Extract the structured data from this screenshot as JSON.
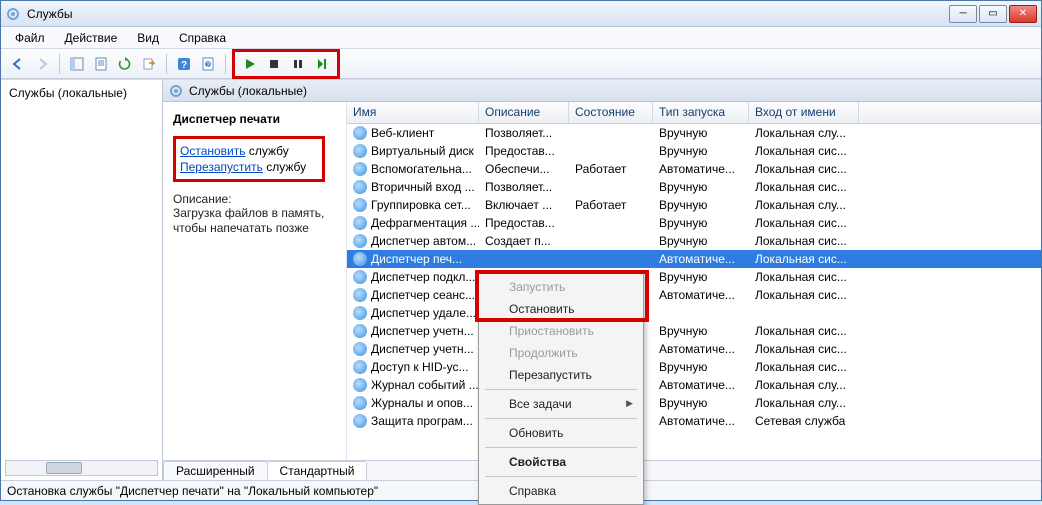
{
  "window": {
    "title": "Службы",
    "min_tooltip": "Свернуть",
    "max_tooltip": "Развернуть",
    "close_tooltip": "Закрыть"
  },
  "menu": {
    "file": "Файл",
    "action": "Действие",
    "view": "Вид",
    "help": "Справка"
  },
  "tree": {
    "root": "Службы (локальные)"
  },
  "pane_header": {
    "title": "Службы (локальные)"
  },
  "detail": {
    "title": "Диспетчер печати",
    "stop_link": "Остановить",
    "stop_suffix": " службу",
    "restart_link": "Перезапустить",
    "restart_suffix": " службу",
    "desc_head": "Описание:",
    "desc_body": "Загрузка файлов в память, чтобы напечатать позже"
  },
  "columns": {
    "name": "Имя",
    "description": "Описание",
    "state": "Состояние",
    "startup": "Тип запуска",
    "logon": "Вход от имени"
  },
  "rows": [
    {
      "name": "Веб-клиент",
      "desc": "Позволяет...",
      "state": "",
      "startup": "Вручную",
      "logon": "Локальная слу..."
    },
    {
      "name": "Виртуальный диск",
      "desc": "Предостав...",
      "state": "",
      "startup": "Вручную",
      "logon": "Локальная сис..."
    },
    {
      "name": "Вспомогательна...",
      "desc": "Обеспечи...",
      "state": "Работает",
      "startup": "Автоматиче...",
      "logon": "Локальная сис..."
    },
    {
      "name": "Вторичный вход ...",
      "desc": "Позволяет...",
      "state": "",
      "startup": "Вручную",
      "logon": "Локальная сис..."
    },
    {
      "name": "Группировка сет...",
      "desc": "Включает ...",
      "state": "Работает",
      "startup": "Вручную",
      "logon": "Локальная слу..."
    },
    {
      "name": "Дефрагментация ...",
      "desc": "Предостав...",
      "state": "",
      "startup": "Вручную",
      "logon": "Локальная сис..."
    },
    {
      "name": "Диспетчер автом...",
      "desc": "Создает п...",
      "state": "",
      "startup": "Вручную",
      "logon": "Локальная сис..."
    },
    {
      "name": "Диспетчер печ...",
      "desc": "",
      "state": "",
      "startup": "Автоматиче...",
      "logon": "Локальная сис...",
      "selected": true
    },
    {
      "name": "Диспетчер подкл...",
      "desc": "",
      "state": "",
      "startup": "Вручную",
      "logon": "Локальная сис..."
    },
    {
      "name": "Диспетчер сеанс...",
      "desc": "",
      "state": "",
      "startup": "Автоматиче...",
      "logon": "Локальная сис..."
    },
    {
      "name": "Диспетчер удале...",
      "desc": "",
      "state": "",
      "startup": "",
      "logon": ""
    },
    {
      "name": "Диспетчер учетн...",
      "desc": "",
      "state": "",
      "startup": "Вручную",
      "logon": "Локальная сис..."
    },
    {
      "name": "Диспетчер учетн...",
      "desc": "",
      "state": "",
      "startup": "Автоматиче...",
      "logon": "Локальная сис..."
    },
    {
      "name": "Доступ к HID-ус...",
      "desc": "",
      "state": "",
      "startup": "Вручную",
      "logon": "Локальная сис..."
    },
    {
      "name": "Журнал событий ...",
      "desc": "",
      "state": "",
      "startup": "Автоматиче...",
      "logon": "Локальная слу..."
    },
    {
      "name": "Журналы и опов...",
      "desc": "",
      "state": "",
      "startup": "Вручную",
      "logon": "Локальная слу..."
    },
    {
      "name": "Защита програм...",
      "desc": "",
      "state": "",
      "startup": "Автоматиче...",
      "logon": "Сетевая служба"
    }
  ],
  "tabs": {
    "extended": "Расширенный",
    "standard": "Стандартный"
  },
  "status": "Остановка службы \"Диспетчер печати\" на \"Локальный компьютер\"",
  "context_menu": {
    "start": "Запустить",
    "stop": "Остановить",
    "pause": "Приостановить",
    "resume": "Продолжить",
    "restart": "Перезапустить",
    "all_tasks": "Все задачи",
    "refresh": "Обновить",
    "properties": "Свойства",
    "help": "Справка"
  }
}
